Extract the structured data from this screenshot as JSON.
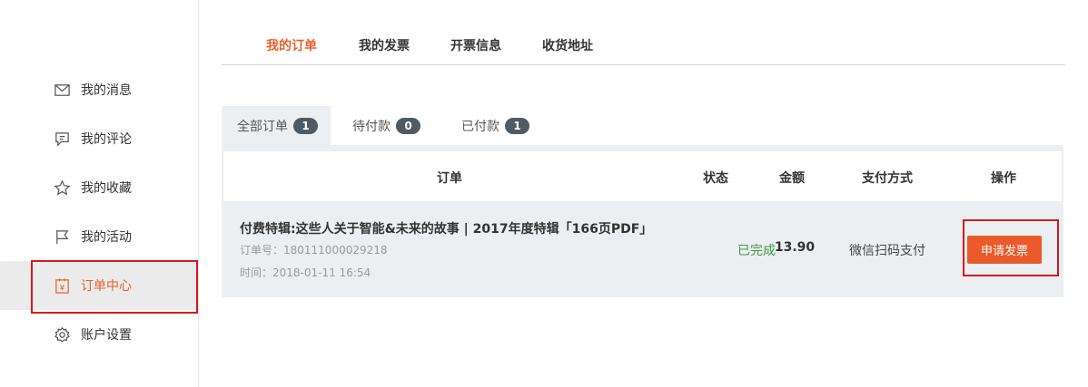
{
  "sidebar": {
    "items": [
      {
        "label": "我的消息",
        "icon": "mail-icon"
      },
      {
        "label": "我的评论",
        "icon": "comment-icon"
      },
      {
        "label": "我的收藏",
        "icon": "star-icon"
      },
      {
        "label": "我的活动",
        "icon": "flag-icon"
      },
      {
        "label": "订单中心",
        "icon": "order-icon",
        "active": true
      },
      {
        "label": "账户设置",
        "icon": "gear-icon"
      }
    ]
  },
  "top_tabs": [
    "我的订单",
    "我的发票",
    "开票信息",
    "收货地址"
  ],
  "sub_tabs": [
    {
      "label": "全部订单",
      "count": "1"
    },
    {
      "label": "待付款",
      "count": "0"
    },
    {
      "label": "已付款",
      "count": "1"
    }
  ],
  "table": {
    "headers": [
      "订单",
      "状态",
      "金额",
      "支付方式",
      "操作"
    ],
    "row": {
      "title": "付费特辑:这些人关于智能&未来的故事 | 2017年度特辑「166页PDF」",
      "order_no": "订单号：180111000029218",
      "time": "时间：2018-01-11 16:54",
      "status": "已完成",
      "amount": "13.90",
      "pay_method": "微信扫码支付",
      "action": "申请发票"
    }
  },
  "colors": {
    "accent": "#e8612c",
    "button": "#ea5a2a",
    "status_done": "#3e9a47",
    "highlight_box": "#d9171e",
    "badge": "#4f5a63"
  }
}
